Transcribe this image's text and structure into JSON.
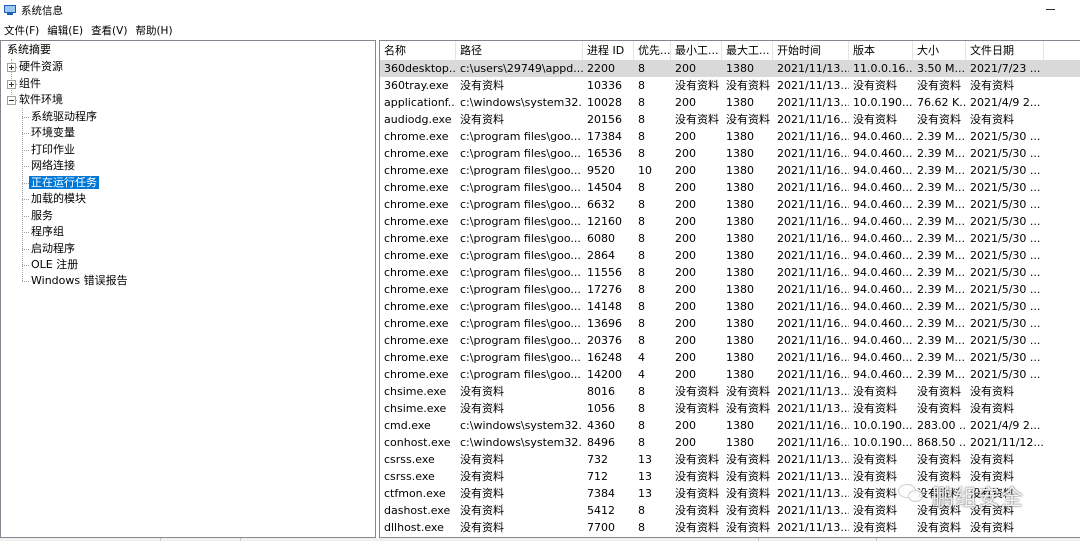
{
  "window": {
    "title": "系统信息"
  },
  "menu": [
    "文件(F)",
    "编辑(E)",
    "查看(V)",
    "帮助(H)"
  ],
  "tree": {
    "root": "系统摘要",
    "nodes": [
      {
        "label": "硬件资源",
        "collapsed": true
      },
      {
        "label": "组件",
        "collapsed": true
      },
      {
        "label": "软件环境",
        "collapsed": false
      }
    ],
    "children": [
      "系统驱动程序",
      "环境变量",
      "打印作业",
      "网络连接",
      "正在运行任务",
      "加载的模块",
      "服务",
      "程序组",
      "启动程序",
      "OLE 注册",
      "Windows 错误报告"
    ],
    "selected": "正在运行任务"
  },
  "table": {
    "columns": [
      "名称",
      "路径",
      "进程 ID",
      "优先...",
      "最小工...",
      "最大工...",
      "开始时间",
      "版本",
      "大小",
      "文件日期"
    ],
    "rows": [
      [
        "360desktop...",
        "c:\\users\\29749\\appd...",
        "2200",
        "8",
        "200",
        "1380",
        "2021/11/13...",
        "11.0.0.16...",
        "3.50 M...",
        "2021/7/23 ..."
      ],
      [
        "360tray.exe",
        "没有资料",
        "10336",
        "8",
        "没有资料",
        "没有资料",
        "2021/11/13...",
        "没有资料",
        "没有资料",
        "没有资料"
      ],
      [
        "applicationf...",
        "c:\\windows\\system32...",
        "10028",
        "8",
        "200",
        "1380",
        "2021/11/13...",
        "10.0.190...",
        "76.62 K...",
        "2021/4/9 2..."
      ],
      [
        "audiodg.exe",
        "没有资料",
        "20156",
        "8",
        "没有资料",
        "没有资料",
        "2021/11/16...",
        "没有资料",
        "没有资料",
        "没有资料"
      ],
      [
        "chrome.exe",
        "c:\\program files\\goo...",
        "17384",
        "8",
        "200",
        "1380",
        "2021/11/16...",
        "94.0.460...",
        "2.39 M...",
        "2021/5/30 ..."
      ],
      [
        "chrome.exe",
        "c:\\program files\\goo...",
        "16536",
        "8",
        "200",
        "1380",
        "2021/11/16...",
        "94.0.460...",
        "2.39 M...",
        "2021/5/30 ..."
      ],
      [
        "chrome.exe",
        "c:\\program files\\goo...",
        "9520",
        "10",
        "200",
        "1380",
        "2021/11/16...",
        "94.0.460...",
        "2.39 M...",
        "2021/5/30 ..."
      ],
      [
        "chrome.exe",
        "c:\\program files\\goo...",
        "14504",
        "8",
        "200",
        "1380",
        "2021/11/16...",
        "94.0.460...",
        "2.39 M...",
        "2021/5/30 ..."
      ],
      [
        "chrome.exe",
        "c:\\program files\\goo...",
        "6632",
        "8",
        "200",
        "1380",
        "2021/11/16...",
        "94.0.460...",
        "2.39 M...",
        "2021/5/30 ..."
      ],
      [
        "chrome.exe",
        "c:\\program files\\goo...",
        "12160",
        "8",
        "200",
        "1380",
        "2021/11/16...",
        "94.0.460...",
        "2.39 M...",
        "2021/5/30 ..."
      ],
      [
        "chrome.exe",
        "c:\\program files\\goo...",
        "6080",
        "8",
        "200",
        "1380",
        "2021/11/16...",
        "94.0.460...",
        "2.39 M...",
        "2021/5/30 ..."
      ],
      [
        "chrome.exe",
        "c:\\program files\\goo...",
        "2864",
        "8",
        "200",
        "1380",
        "2021/11/16...",
        "94.0.460...",
        "2.39 M...",
        "2021/5/30 ..."
      ],
      [
        "chrome.exe",
        "c:\\program files\\goo...",
        "11556",
        "8",
        "200",
        "1380",
        "2021/11/16...",
        "94.0.460...",
        "2.39 M...",
        "2021/5/30 ..."
      ],
      [
        "chrome.exe",
        "c:\\program files\\goo...",
        "17276",
        "8",
        "200",
        "1380",
        "2021/11/16...",
        "94.0.460...",
        "2.39 M...",
        "2021/5/30 ..."
      ],
      [
        "chrome.exe",
        "c:\\program files\\goo...",
        "14148",
        "8",
        "200",
        "1380",
        "2021/11/16...",
        "94.0.460...",
        "2.39 M...",
        "2021/5/30 ..."
      ],
      [
        "chrome.exe",
        "c:\\program files\\goo...",
        "13696",
        "8",
        "200",
        "1380",
        "2021/11/16...",
        "94.0.460...",
        "2.39 M...",
        "2021/5/30 ..."
      ],
      [
        "chrome.exe",
        "c:\\program files\\goo...",
        "20376",
        "8",
        "200",
        "1380",
        "2021/11/16...",
        "94.0.460...",
        "2.39 M...",
        "2021/5/30 ..."
      ],
      [
        "chrome.exe",
        "c:\\program files\\goo...",
        "16248",
        "4",
        "200",
        "1380",
        "2021/11/16...",
        "94.0.460...",
        "2.39 M...",
        "2021/5/30 ..."
      ],
      [
        "chrome.exe",
        "c:\\program files\\goo...",
        "14200",
        "4",
        "200",
        "1380",
        "2021/11/16...",
        "94.0.460...",
        "2.39 M...",
        "2021/5/30 ..."
      ],
      [
        "chsime.exe",
        "没有资料",
        "8016",
        "8",
        "没有资料",
        "没有资料",
        "2021/11/13...",
        "没有资料",
        "没有资料",
        "没有资料"
      ],
      [
        "chsime.exe",
        "没有资料",
        "1056",
        "8",
        "没有资料",
        "没有资料",
        "2021/11/13...",
        "没有资料",
        "没有资料",
        "没有资料"
      ],
      [
        "cmd.exe",
        "c:\\windows\\system32...",
        "4360",
        "8",
        "200",
        "1380",
        "2021/11/16...",
        "10.0.190...",
        "283.00 ...",
        "2021/4/9 2..."
      ],
      [
        "conhost.exe",
        "c:\\windows\\system32...",
        "8496",
        "8",
        "200",
        "1380",
        "2021/11/16...",
        "10.0.190...",
        "868.50 ...",
        "2021/11/12..."
      ],
      [
        "csrss.exe",
        "没有资料",
        "732",
        "13",
        "没有资料",
        "没有资料",
        "2021/11/13...",
        "没有资料",
        "没有资料",
        "没有资料"
      ],
      [
        "csrss.exe",
        "没有资料",
        "712",
        "13",
        "没有资料",
        "没有资料",
        "2021/11/13...",
        "没有资料",
        "没有资料",
        "没有资料"
      ],
      [
        "ctfmon.exe",
        "没有资料",
        "7384",
        "13",
        "没有资料",
        "没有资料",
        "2021/11/13...",
        "没有资料",
        "没有资料",
        "没有资料"
      ],
      [
        "dashost.exe",
        "没有资料",
        "5412",
        "8",
        "没有资料",
        "没有资料",
        "2021/11/13...",
        "没有资料",
        "没有资料",
        "没有资料"
      ],
      [
        "dllhost.exe",
        "没有资料",
        "7700",
        "8",
        "没有资料",
        "没有资料",
        "2021/11/13...",
        "没有资料",
        "没有资料",
        "没有资料"
      ]
    ],
    "selected_row": 0
  },
  "watermark": {
    "text": "鹏组安全",
    "icon": "wechat-icon"
  }
}
